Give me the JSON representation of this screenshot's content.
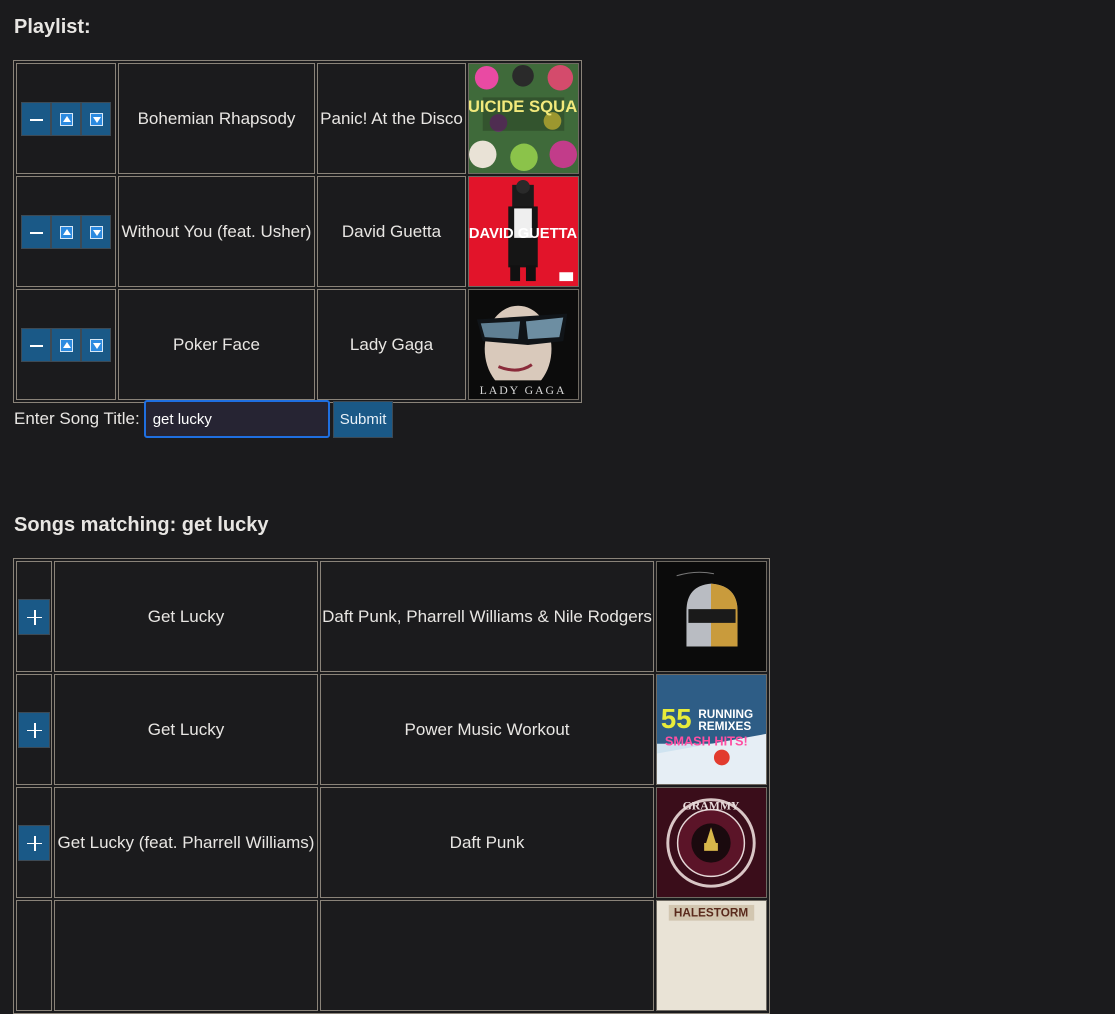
{
  "playlist": {
    "heading": "Playlist:",
    "rows": [
      {
        "title": "Bohemian Rhapsody",
        "artist": "Panic! At the Disco",
        "art_icon": "suicide-squad-album-art",
        "art_text": "SUICIDE SQUAD"
      },
      {
        "title": "Without You (feat. Usher)",
        "artist": "David Guetta",
        "art_icon": "nothing-but-the-beat-album-art",
        "art_text": "DAVID GUETTA"
      },
      {
        "title": "Poker Face",
        "artist": "Lady Gaga",
        "art_icon": "the-fame-album-art",
        "art_text": "LADY GAGA"
      }
    ]
  },
  "search": {
    "label": "Enter Song Title:",
    "value": "get lucky",
    "submit_label": "Submit"
  },
  "results": {
    "heading": "Songs matching: get lucky",
    "rows": [
      {
        "title": "Get Lucky",
        "artist": "Daft Punk, Pharrell Williams & Nile Rodgers",
        "art_icon": "random-access-memories-album-art"
      },
      {
        "title": "Get Lucky",
        "artist": "Power Music Workout",
        "art_icon": "55-running-remixes-album-art",
        "art_text": "55 RUNNING REMIXES SMASH HITS!"
      },
      {
        "title": "Get Lucky (feat. Pharrell Williams)",
        "artist": "Daft Punk",
        "art_icon": "grammy-nominees-album-art",
        "art_text": "GRAMMY"
      }
    ],
    "partial_row_art_text": "HALESTORM"
  },
  "colors": {
    "background": "#1b1b1d",
    "button": "#1a5987",
    "input_focus": "#1f6fe0"
  }
}
